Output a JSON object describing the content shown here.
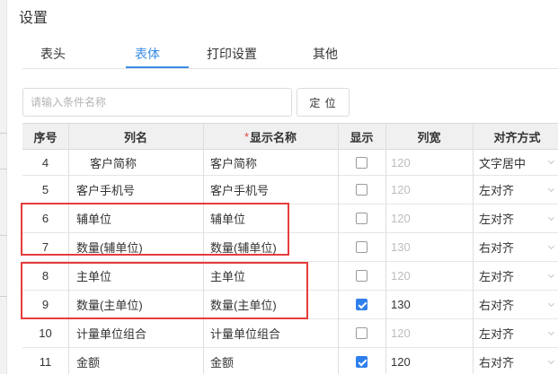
{
  "window": {
    "title": "设置"
  },
  "tabs": [
    {
      "label": "表头",
      "active": false
    },
    {
      "label": "表体",
      "active": true
    },
    {
      "label": "打印设置",
      "active": false
    },
    {
      "label": "其他",
      "active": false
    }
  ],
  "search": {
    "placeholder": "请输入条件名称",
    "locate_label": "定 位"
  },
  "columns": {
    "seq": "序号",
    "name": "列名",
    "display_required_mark": "*",
    "display": "显示名称",
    "show": "显示",
    "width": "列宽",
    "align": "对齐方式"
  },
  "rows": [
    {
      "seq": "4",
      "name": "客户简称",
      "display": "客户简称",
      "shown": false,
      "width": "120",
      "align": "文字居中"
    },
    {
      "seq": "5",
      "name": "客户手机号",
      "display": "客户手机号",
      "shown": false,
      "width": "120",
      "align": "左对齐"
    },
    {
      "seq": "6",
      "name": "辅单位",
      "display": "辅单位",
      "shown": false,
      "width": "120",
      "align": "左对齐"
    },
    {
      "seq": "7",
      "name": "数量(辅单位)",
      "display": "数量(辅单位)",
      "shown": false,
      "width": "130",
      "align": "右对齐"
    },
    {
      "seq": "8",
      "name": "主单位",
      "display": "主单位",
      "shown": false,
      "width": "120",
      "align": "左对齐"
    },
    {
      "seq": "9",
      "name": "数量(主单位)",
      "display": "数量(主单位)",
      "shown": true,
      "width": "130",
      "align": "右对齐"
    },
    {
      "seq": "10",
      "name": "计量单位组合",
      "display": "计量单位组合",
      "shown": false,
      "width": "120",
      "align": "左对齐"
    },
    {
      "seq": "11",
      "name": "金额",
      "display": "金额",
      "shown": true,
      "width": "120",
      "align": "右对齐"
    }
  ],
  "colors": {
    "accent": "#3a8ee6",
    "checkbox": "#2f80ed",
    "highlight": "#e63c3c",
    "required": "#e0463a"
  }
}
